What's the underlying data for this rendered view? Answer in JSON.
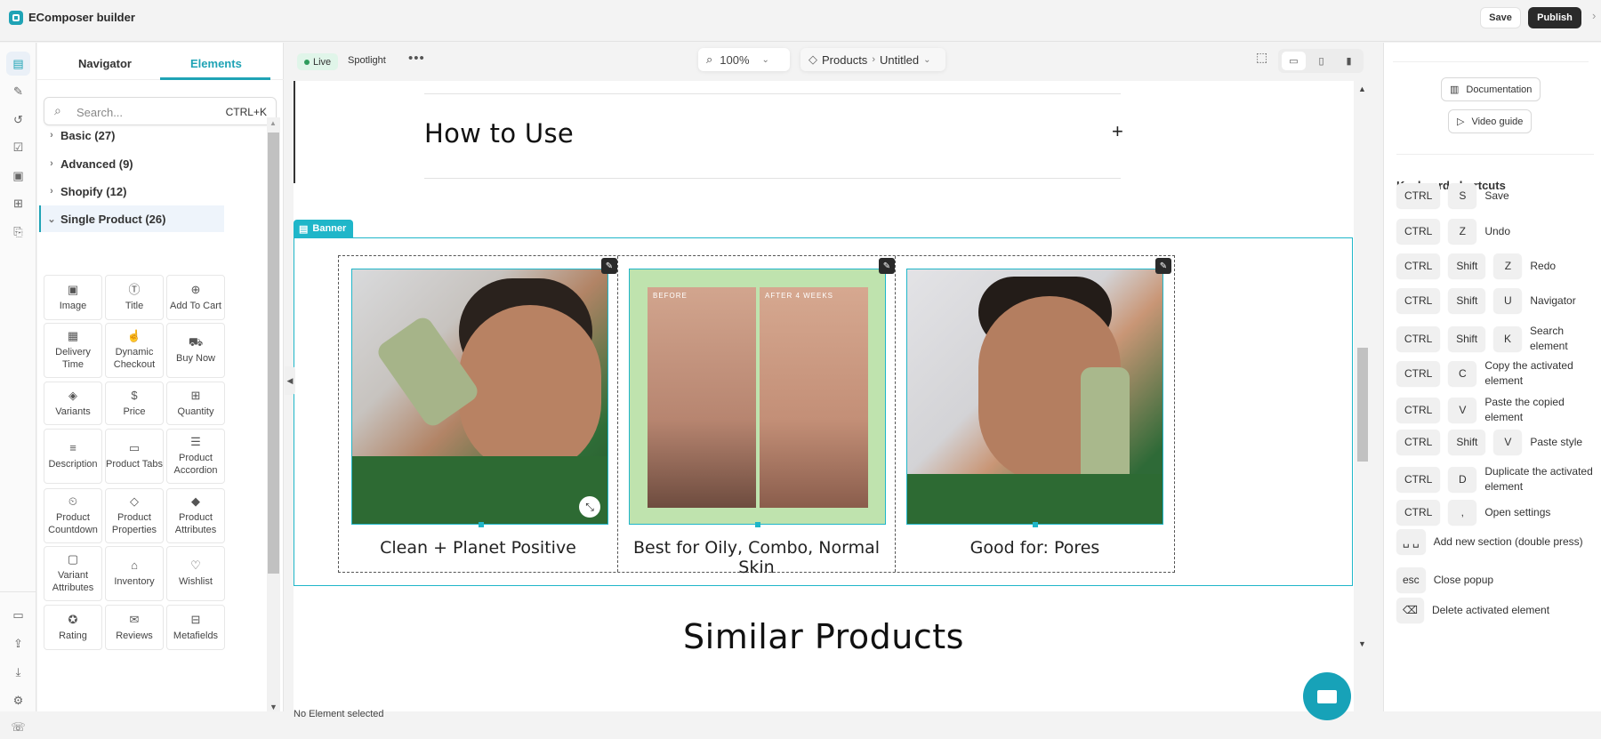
{
  "app": {
    "title": "EComposer builder",
    "save_label": "Save",
    "publish_label": "Publish",
    "close_glyph": "›"
  },
  "rail": {
    "top_icons": [
      "layout-icon",
      "brush-icon",
      "history-icon",
      "checklist-icon",
      "template-icon",
      "apps-icon",
      "add-page-icon"
    ],
    "bottom_icons": [
      "folder-star-icon",
      "upload-icon",
      "download-icon",
      "settings-icon",
      "chat-icon"
    ]
  },
  "left_panel": {
    "tabs": [
      {
        "label": "Navigator",
        "active": false
      },
      {
        "label": "Elements",
        "active": true
      }
    ],
    "search": {
      "placeholder": "Search...",
      "shortcut": "CTRL+K"
    },
    "categories": [
      {
        "label": "Basic (27)",
        "expanded": false
      },
      {
        "label": "Advanced (9)",
        "expanded": false
      },
      {
        "label": "Shopify (12)",
        "expanded": false
      },
      {
        "label": "Single Product (26)",
        "expanded": true
      }
    ],
    "elements": [
      {
        "label": "Image",
        "icon": "image-icon",
        "glyph": "▣"
      },
      {
        "label": "Title",
        "icon": "title-icon",
        "glyph": "Ⓣ"
      },
      {
        "label": "Add To Cart",
        "icon": "add-to-cart-icon",
        "glyph": "⊕"
      },
      {
        "label": "Delivery Time",
        "icon": "delivery-time-icon",
        "glyph": "▦"
      },
      {
        "label": "Dynamic Checkout",
        "icon": "dynamic-checkout-icon",
        "glyph": "☝"
      },
      {
        "label": "Buy Now",
        "icon": "buy-now-icon",
        "glyph": "⛟"
      },
      {
        "label": "Variants",
        "icon": "variants-icon",
        "glyph": "◈"
      },
      {
        "label": "Price",
        "icon": "price-icon",
        "glyph": "$"
      },
      {
        "label": "Quantity",
        "icon": "quantity-icon",
        "glyph": "⊞"
      },
      {
        "label": "Description",
        "icon": "description-icon",
        "glyph": "≡"
      },
      {
        "label": "Product Tabs",
        "icon": "product-tabs-icon",
        "glyph": "▭"
      },
      {
        "label": "Product Accordion",
        "icon": "product-accordion-icon",
        "glyph": "☰"
      },
      {
        "label": "Product Countdown",
        "icon": "product-countdown-icon",
        "glyph": "⏲"
      },
      {
        "label": "Product Properties",
        "icon": "product-properties-icon",
        "glyph": "◇"
      },
      {
        "label": "Product Attributes",
        "icon": "product-attributes-icon",
        "glyph": "◆"
      },
      {
        "label": "Variant Attributes",
        "icon": "variant-attributes-icon",
        "glyph": "▢"
      },
      {
        "label": "Inventory",
        "icon": "inventory-icon",
        "glyph": "⌂"
      },
      {
        "label": "Wishlist",
        "icon": "wishlist-icon",
        "glyph": "♡"
      },
      {
        "label": "Rating",
        "icon": "rating-icon",
        "glyph": "✪"
      },
      {
        "label": "Reviews",
        "icon": "reviews-icon",
        "glyph": "✉"
      },
      {
        "label": "Metafields",
        "icon": "metafields-icon",
        "glyph": "⊟"
      }
    ]
  },
  "canvas_toolbar": {
    "live_label": "Live",
    "spotlight_label": "Spotlight",
    "more_glyph": "•••",
    "zoom": "100%",
    "breadcrumb": [
      "Products",
      "Untitled"
    ]
  },
  "page": {
    "accordion_title": "How to Use",
    "accordion_toggle": "+",
    "banner_tag": "Banner",
    "banner_items": [
      {
        "caption": "Clean + Planet Positive",
        "image": "man holding serum bottle dropper"
      },
      {
        "caption": "Best for Oily, Combo, Normal Skin",
        "image": "before / after skin comparison",
        "overlay_labels": [
          "BEFORE",
          "AFTER 4 WEEKS"
        ]
      },
      {
        "caption": "Good for: Pores",
        "image": "smiling man holding Deep Sweep bottle"
      }
    ],
    "similar_title": "Similar Products",
    "status": "No Element selected"
  },
  "right_panel": {
    "documentation_label": "Documentation",
    "video_guide_label": "Video guide",
    "shortcuts_title": "Keyboard shortcuts",
    "shortcuts": [
      {
        "keys": [
          "CTRL",
          "S"
        ],
        "label": "Save"
      },
      {
        "keys": [
          "CTRL",
          "Z"
        ],
        "label": "Undo"
      },
      {
        "keys": [
          "CTRL",
          "Shift",
          "Z"
        ],
        "label": "Redo"
      },
      {
        "keys": [
          "CTRL",
          "Shift",
          "U"
        ],
        "label": "Navigator"
      },
      {
        "keys": [
          "CTRL",
          "Shift",
          "K"
        ],
        "label": "Search element"
      },
      {
        "keys": [
          "CTRL",
          "C"
        ],
        "label": "Copy the activated element"
      },
      {
        "keys": [
          "CTRL",
          "V"
        ],
        "label": "Paste the copied element"
      },
      {
        "keys": [
          "CTRL",
          "Shift",
          "V"
        ],
        "label": "Paste style"
      },
      {
        "keys": [
          "CTRL",
          "D"
        ],
        "label": "Duplicate the activated element"
      },
      {
        "keys": [
          "CTRL",
          ","
        ],
        "label": "Open settings"
      },
      {
        "keys": [
          "␣ ␣"
        ],
        "label": "Add new section (double press)"
      },
      {
        "keys": [
          "esc"
        ],
        "label": "Close popup"
      },
      {
        "keys": [
          "⌫"
        ],
        "label": "Delete activated element"
      }
    ]
  },
  "colors": {
    "accent": "#1fa3b5",
    "banner": "#1fb6c9",
    "publish_bg": "#2a2a2a",
    "live_bg": "#e0f5e9",
    "live_dot": "#2d9c5c",
    "chat_fab": "#17a2b8"
  }
}
